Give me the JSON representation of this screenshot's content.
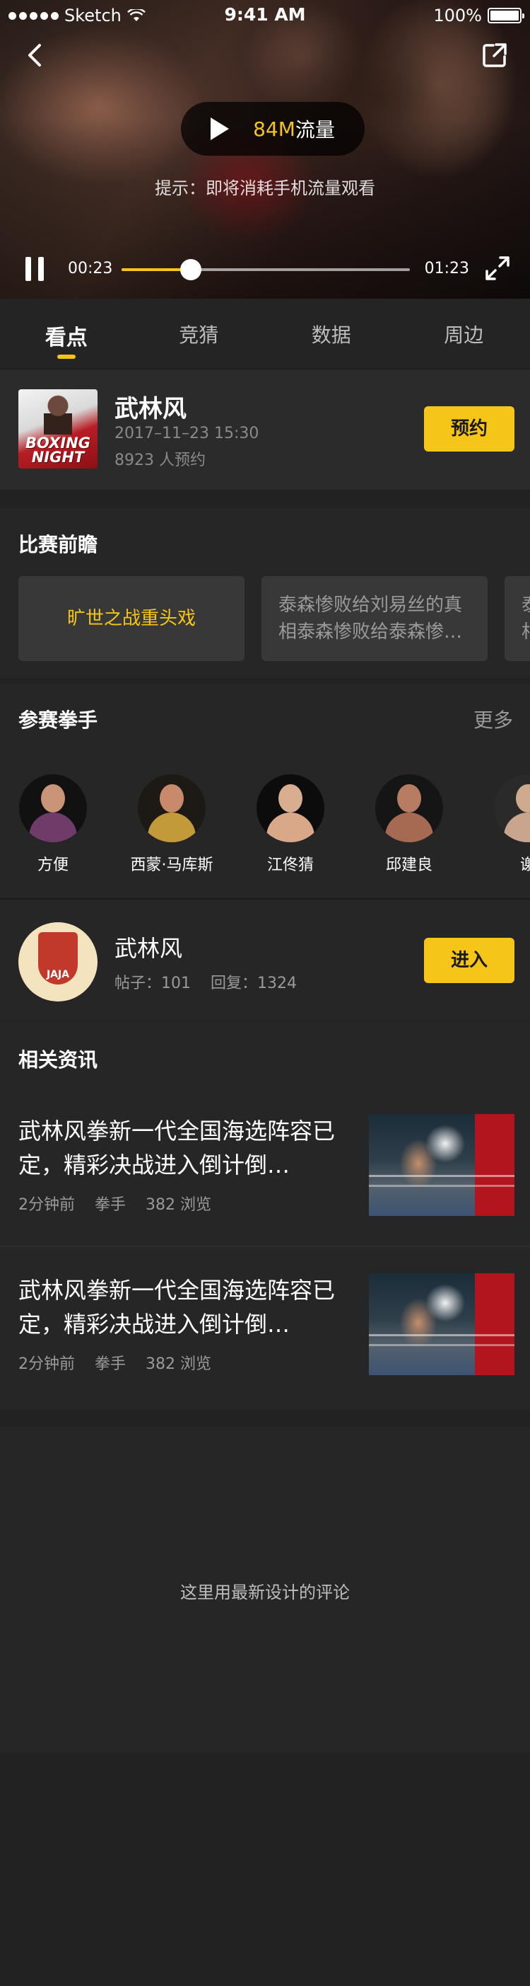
{
  "status_bar": {
    "carrier": "Sketch",
    "time": "9:41 AM",
    "battery": "100%"
  },
  "video": {
    "data_size": "84M",
    "data_unit": "流量",
    "tip": "提示：即将消耗手机流量观看",
    "current_time": "00:23",
    "total_time": "01:23",
    "progress": 0.24
  },
  "tabs": [
    "看点",
    "竞猜",
    "数据",
    "周边"
  ],
  "event": {
    "poster_text": "BOXING NIGHT",
    "title": "武林风",
    "date": "2017–11–23 15:30",
    "reservations": "8923 人预约",
    "button": "预约"
  },
  "preview": {
    "title": "比赛前瞻",
    "cards": [
      "旷世之战重头戏",
      "泰森惨败给刘易丝的真相泰森惨败给泰森惨…",
      "泰相"
    ]
  },
  "boxers": {
    "title": "参赛拳手",
    "more": "更多",
    "list": [
      "方便",
      "西蒙·马库斯",
      "江佟猜",
      "邱建良",
      "谢"
    ]
  },
  "club": {
    "logo_text": "JAJA",
    "name": "武林风",
    "posts": "帖子：101",
    "replies": "回复：1324",
    "button": "进入"
  },
  "news": {
    "title": "相关资讯",
    "items": [
      {
        "title": "武林风拳新一代全国海选阵容已定，精彩决战进入倒计倒…",
        "time": "2分钟前",
        "category": "拳手",
        "views": "382 浏览"
      },
      {
        "title": "武林风拳新一代全国海选阵容已定，精彩决战进入倒计倒…",
        "time": "2分钟前",
        "category": "拳手",
        "views": "382 浏览"
      }
    ]
  },
  "comments": {
    "placeholder": "这里用最新设计的评论"
  },
  "colors": {
    "accent": "#F5C518",
    "background": "#222222",
    "card": "#2b2b2b"
  }
}
